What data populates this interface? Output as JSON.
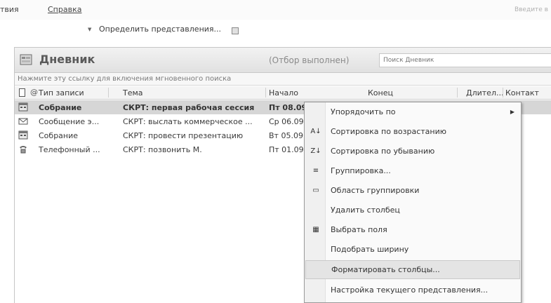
{
  "menubar": {
    "item_partial": "твия",
    "help": "Справка",
    "search_hint": "Введите в"
  },
  "viewbar": {
    "define_views": "Определить представления..."
  },
  "pane": {
    "title": "Дневник",
    "filter_status": "(Отбор выполнен)",
    "search_placeholder": "Поиск Дневник",
    "instant_search_link": "Нажмите эту ссылку для включения мгновенного поиска"
  },
  "columns": {
    "type": "Тип записи",
    "subject": "Тема",
    "start": "Начало",
    "end": "Конец",
    "duration": "Длител...",
    "contact": "Контакт"
  },
  "rows": [
    {
      "type": "Собрание",
      "subject": "СКРТ: первая рабочая сессия",
      "start": "Пт 08.09",
      "icon": "meeting-icon"
    },
    {
      "type": "Сообщение э...",
      "subject": "СКРТ: выслать коммерческое ...",
      "start": "Ср 06.09",
      "icon": "email-icon"
    },
    {
      "type": "Собрание",
      "subject": "СКРТ: провести презентацию",
      "start": "Вт 05.09",
      "icon": "meeting-icon"
    },
    {
      "type": "Телефонный ...",
      "subject": "СКРТ: позвонить М.",
      "start": "Пт 01.09",
      "icon": "phone-icon"
    }
  ],
  "context_menu": {
    "sort_by": "Упорядочить по",
    "sort_asc": "Сортировка по возрастанию",
    "sort_desc": "Сортировка по убыванию",
    "group_by": "Группировка...",
    "group_area": "Область группировки",
    "remove_column": "Удалить столбец",
    "field_chooser": "Выбрать поля",
    "best_fit": "Подобрать ширину",
    "format_columns": "Форматировать столбцы...",
    "customize_view": "Настройка текущего представления..."
  },
  "colors": {
    "selected_row": "#d6d6d6",
    "menu_highlight": "#e4e4e4"
  }
}
